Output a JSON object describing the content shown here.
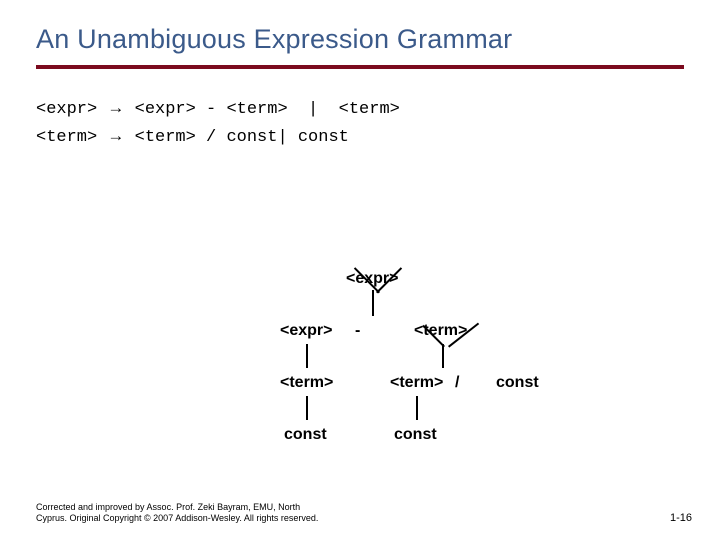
{
  "title": "An Unambiguous Expression Grammar",
  "grammar": {
    "line1_pre": "<expr>",
    "line1_post": " <expr> - <term>  |  <term>",
    "line2_pre": "<term>",
    "line2_post": " <term> / const| const",
    "arrow": "→"
  },
  "tree": {
    "n_root": "<expr>",
    "n_l_expr": "<expr>",
    "n_minus": "-",
    "n_r_term": "<term>",
    "n_l_term": "<term>",
    "n_rl_term": "<term>",
    "n_slash": "/",
    "n_r_const": "const",
    "n_ll_const": "const",
    "n_rl_const": "const"
  },
  "footer": {
    "line1": "Corrected and improved by Assoc. Prof. Zeki Bayram, EMU, North",
    "line2": "Cyprus. Original Copyright © 2007 Addison-Wesley. All rights reserved."
  },
  "pagenum": "1-16"
}
